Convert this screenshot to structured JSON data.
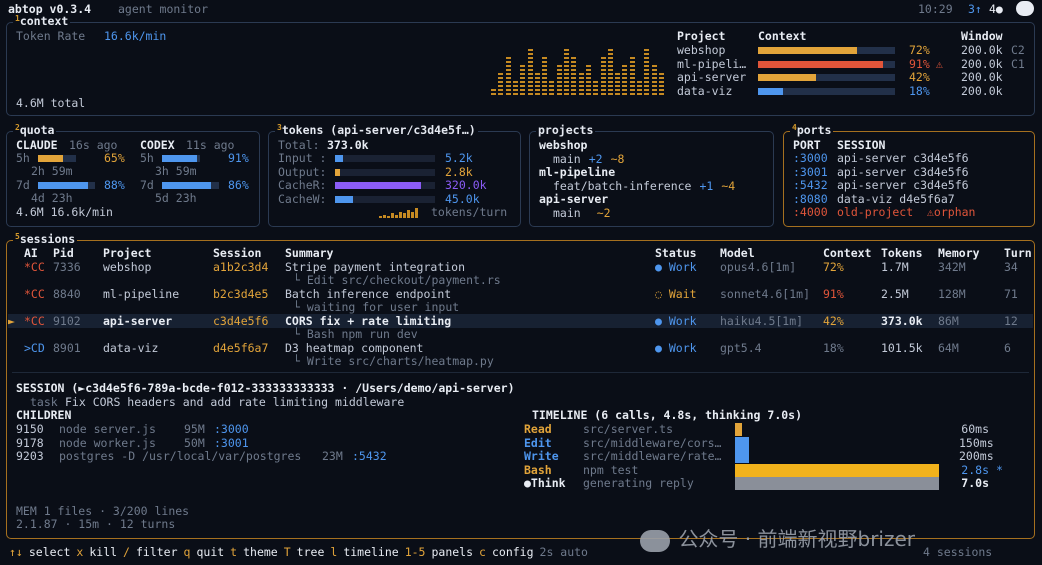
{
  "header": {
    "app": "abtop v0.3.4",
    "subtitle": "agent monitor",
    "time": "10:29",
    "badge_blue": "3↑",
    "badge_white": "4●"
  },
  "context": {
    "num": "1",
    "title": "context",
    "rate_label": "Token Rate",
    "rate_value": "16.6k/min",
    "total": "4.6M total",
    "cols": {
      "project": "Project",
      "context": "Context",
      "window": "Window"
    },
    "rows": [
      {
        "project": "webshop",
        "pct": "72%",
        "fill": 0.72,
        "color": "#e2a43a",
        "window": "200.0k",
        "tag": "C2",
        "warn": ""
      },
      {
        "project": "ml-pipeli…",
        "pct": "91%",
        "fill": 0.91,
        "color": "#e0553a",
        "window": "200.0k",
        "tag": "C1",
        "warn": "⚠"
      },
      {
        "project": "api-server",
        "pct": "42%",
        "fill": 0.42,
        "color": "#e2a43a",
        "window": "200.0k",
        "tag": "",
        "warn": ""
      },
      {
        "project": "data-viz",
        "pct": "18%",
        "fill": 0.18,
        "color": "#4e96ee",
        "window": "200.0k",
        "tag": "",
        "warn": ""
      }
    ]
  },
  "quota": {
    "num": "2",
    "title": "quota",
    "claude": {
      "name": "CLAUDE",
      "ago": "16s ago",
      "h5": "5h",
      "p5": "65%",
      "f5": 0.65,
      "reset5": "2h 59m",
      "d7": "7d",
      "p7": "88%",
      "f7": 0.88,
      "reset7": "4d 23h"
    },
    "codex": {
      "name": "CODEX",
      "ago": "11s ago",
      "h5": "5h",
      "p5": "91%",
      "f5": 0.91,
      "reset5": "3h 59m",
      "d7": "7d",
      "p7": "86%",
      "f7": 0.86,
      "reset7": "5d 23h"
    },
    "footer": "4.6M 16.6k/min"
  },
  "tokens": {
    "num": "3",
    "title": "tokens (api-server/c3d4e5f…)",
    "total_label": "Total:",
    "total": "373.0k",
    "rows": [
      {
        "label": "Input :",
        "value": "5.2k",
        "color": "#4e96ee",
        "fill": 0.08
      },
      {
        "label": "Output:",
        "value": "2.8k",
        "color": "#e2a43a",
        "fill": 0.05
      },
      {
        "label": "CacheR:",
        "value": "320.0k",
        "color": "#8b5cf6",
        "fill": 0.86
      },
      {
        "label": "CacheW:",
        "value": "45.0k",
        "color": "#4e96ee",
        "fill": 0.18
      }
    ],
    "footer": "tokens/turn"
  },
  "projects": {
    "title": "projects",
    "items": [
      {
        "name": "webshop",
        "branch": "main",
        "plus": "+2",
        "tilde": "~8"
      },
      {
        "name": "ml-pipeline",
        "branch": "feat/batch-inference",
        "plus": "+1",
        "tilde": "~4"
      },
      {
        "name": "api-server",
        "branch": "main",
        "plus": "",
        "tilde": "~2"
      }
    ]
  },
  "ports": {
    "num": "4",
    "title": "ports",
    "cols": {
      "port": "PORT",
      "session": "SESSION"
    },
    "rows": [
      {
        "port": ":3000",
        "session": "api-server c3d4e5f6",
        "note": ""
      },
      {
        "port": ":3001",
        "session": "api-server c3d4e5f6",
        "note": ""
      },
      {
        "port": ":5432",
        "session": "api-server c3d4e5f6",
        "note": ""
      },
      {
        "port": ":8080",
        "session": "data-viz d4e5f6a7",
        "note": ""
      },
      {
        "port": ":4000",
        "session": "old-project",
        "note": "⚠orphan"
      }
    ]
  },
  "sessions": {
    "num": "5",
    "title": "sessions",
    "cols": {
      "ai": "AI",
      "pid": "Pid",
      "project": "Project",
      "session": "Session",
      "summary": "Summary",
      "status": "Status",
      "model": "Model",
      "context": "Context",
      "tokens": "Tokens",
      "memory": "Memory",
      "turn": "Turn"
    },
    "rows": [
      {
        "sel": "",
        "ai": "*CC",
        "pid": "7336",
        "project": "webshop",
        "session": "a1b2c3d4",
        "summary": "Stripe payment integration",
        "sub": "└ Edit src/checkout/payment.rs",
        "status": "● Work",
        "model": "opus4.6[1m]",
        "context": "72%",
        "tokens": "1.7M",
        "memory": "342M",
        "turn": "34"
      },
      {
        "sel": "",
        "ai": "*CC",
        "pid": "8840",
        "project": "ml-pipeline",
        "session": "b2c3d4e5",
        "summary": "Batch inference endpoint",
        "sub": "└ waiting for user input",
        "status": "◌ Wait",
        "model": "sonnet4.6[1m]",
        "context": "91%",
        "tokens": "2.5M",
        "memory": "128M",
        "turn": "71"
      },
      {
        "sel": "►",
        "ai": "*CC",
        "pid": "9102",
        "project": "api-server",
        "session": "c3d4e5f6",
        "summary": "CORS fix + rate limiting",
        "sub": "└ Bash npm run dev",
        "status": "● Work",
        "model": "haiku4.5[1m]",
        "context": "42%",
        "tokens": "373.0k",
        "memory": "86M",
        "turn": "12"
      },
      {
        "sel": "",
        "ai": ">CD",
        "pid": "8901",
        "project": "data-viz",
        "session": "d4e5f6a7",
        "summary": "D3 heatmap component",
        "sub": "└ Write src/charts/heatmap.py",
        "status": "● Work",
        "model": "gpt5.4",
        "context": "18%",
        "tokens": "101.5k",
        "memory": "64M",
        "turn": "6"
      }
    ]
  },
  "detail": {
    "header": "SESSION (►c3d4e5f6-789a-bcde-f012-333333333333 · /Users/demo/api-server)",
    "task_label": "task",
    "task": "Fix CORS headers and add rate limiting middleware",
    "children_title": "CHILDREN",
    "children": [
      {
        "pid": "9150",
        "cmd": "node server.js",
        "mem": "95M",
        "port": ":3000"
      },
      {
        "pid": "9178",
        "cmd": "node worker.js",
        "mem": "50M",
        "port": ":3001"
      },
      {
        "pid": "9203",
        "cmd": "postgres -D /usr/local/var/postgres",
        "mem": "23M",
        "port": ":5432"
      }
    ],
    "mem_line": "MEM 1 files · 3/200 lines",
    "version_line": "2.1.87 · 15m · 12 turns",
    "timeline_title": "TIMELINE (6 calls, 4.8s, thinking 7.0s)",
    "timeline": [
      {
        "tool": "Read",
        "file": "src/server.ts",
        "dur": "60ms",
        "color": "#e2a43a",
        "frac": 0.03,
        "mark": ""
      },
      {
        "tool": "Edit",
        "file": "src/middleware/cors…",
        "dur": "150ms",
        "color": "#4e96ee",
        "frac": 0.07,
        "mark": ""
      },
      {
        "tool": "Write",
        "file": "src/middleware/rate…",
        "dur": "200ms",
        "color": "#4e96ee",
        "frac": 0.07,
        "mark": ""
      },
      {
        "tool": "Bash",
        "file": "npm test",
        "dur": "2.8s",
        "color": "#f2b21c",
        "frac": 1.0,
        "mark": "*"
      },
      {
        "tool": "●Think",
        "file": "generating reply",
        "dur": "7.0s",
        "color": "#8a8f99",
        "frac": 1.0,
        "mark": ""
      }
    ]
  },
  "watermark": "公众号 · 前端新视野brizer",
  "footer": {
    "keys": [
      {
        "k": "↑↓",
        "label": "select"
      },
      {
        "k": "x",
        "label": "kill"
      },
      {
        "k": "/",
        "label": "filter"
      },
      {
        "k": "q",
        "label": "quit"
      },
      {
        "k": "t",
        "label": "theme"
      },
      {
        "k": "T",
        "label": "tree"
      },
      {
        "k": "l",
        "label": "timeline"
      },
      {
        "k": "1-5",
        "label": "panels"
      },
      {
        "k": "c",
        "label": "config"
      }
    ],
    "auto": "2s auto",
    "sessions": "4 sessions"
  },
  "colors": {
    "accent": "#e2a43a",
    "blue": "#4e96ee",
    "red": "#e0553a",
    "violet": "#8b5cf6",
    "bg": "#0a0e17"
  }
}
